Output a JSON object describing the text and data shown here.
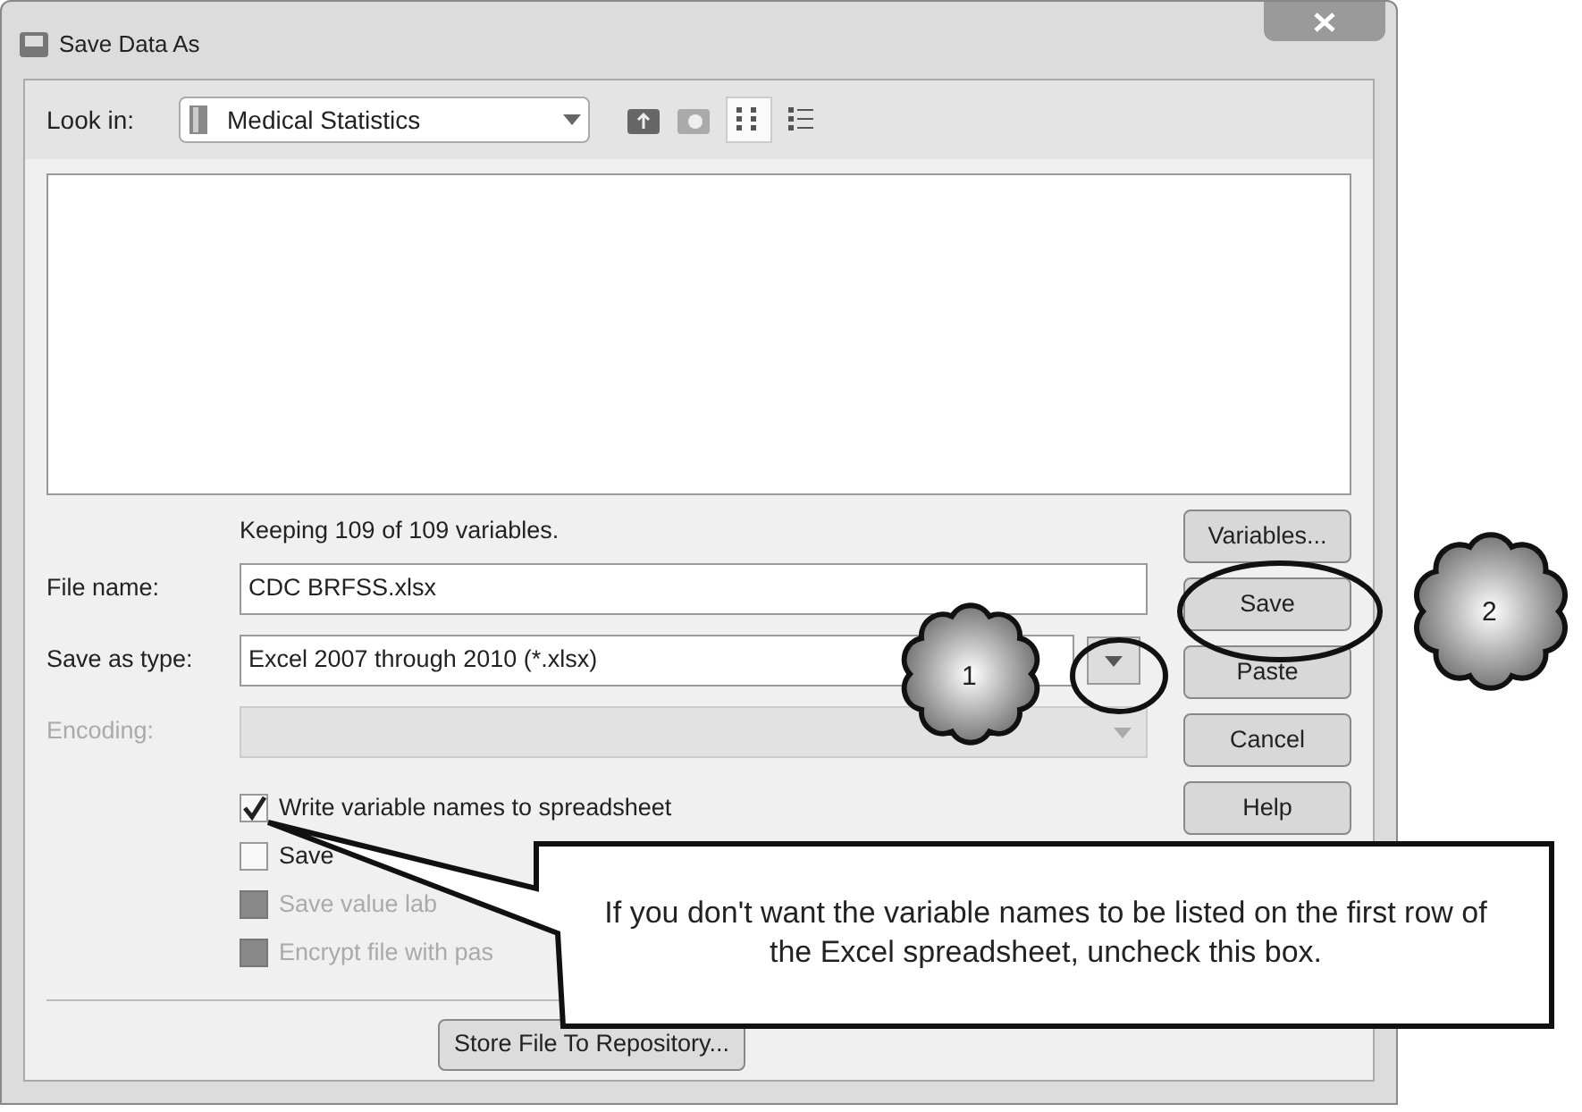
{
  "window": {
    "title": "Save Data As"
  },
  "look_in": {
    "label": "Look in:",
    "value": "Medical Statistics"
  },
  "status": "Keeping 109 of 109 variables.",
  "fields": [
    {
      "label": "File name:",
      "value": "CDC BRFSS.xlsx",
      "kind": "text"
    },
    {
      "label": "Save as type:",
      "value": "Excel 2007 through 2010 (*.xlsx)",
      "kind": "dropdown",
      "disabled": false
    },
    {
      "label": "Encoding:",
      "kind": "dropdown",
      "disabled": true
    }
  ],
  "options": [
    {
      "label": "Write variable names to spreadsheet",
      "checked": true,
      "disabled": false
    },
    {
      "label": "Save",
      "checked": false,
      "disabled": false
    },
    {
      "label": "Save value lab",
      "checked": false,
      "disabled": true
    },
    {
      "label": "Encrypt file with pas",
      "checked": false,
      "disabled": true
    }
  ],
  "buttons": [
    "Variables...",
    "Save",
    "Paste",
    "Cancel",
    "Help"
  ],
  "repository_button": "Store File To Repository...",
  "callout": "If you don't want the variable names to be listed on the first row of the Excel spreadsheet, uncheck this box.",
  "markers": [
    "1",
    "2"
  ]
}
